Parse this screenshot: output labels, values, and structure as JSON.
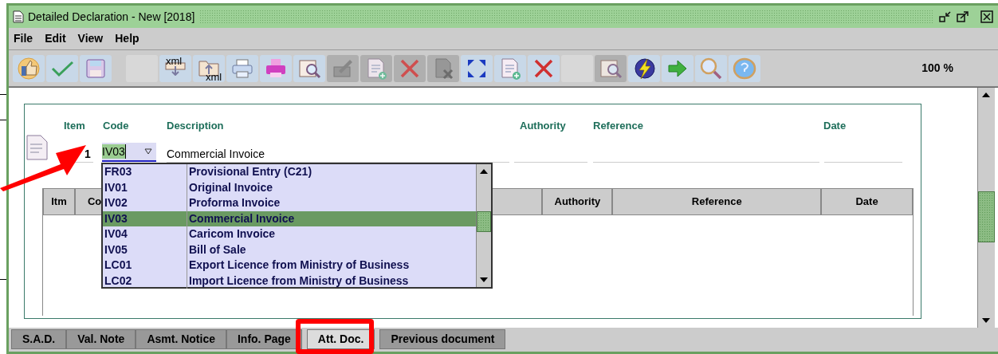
{
  "window": {
    "title": "Detailed Declaration - New [2018]"
  },
  "menu": [
    "File",
    "Edit",
    "View",
    "Help"
  ],
  "toolbar": {
    "buttons": [
      {
        "disabled": false
      },
      {
        "disabled": false
      },
      {
        "disabled": false
      },
      {
        "disabled": true
      },
      {
        "disabled": false,
        "label": "xml"
      },
      {
        "disabled": false,
        "label": "xml"
      },
      {
        "disabled": false
      },
      {
        "disabled": false
      },
      {
        "disabled": false
      },
      {
        "disabled": true
      },
      {
        "disabled": true
      },
      {
        "disabled": true
      },
      {
        "disabled": true
      },
      {
        "disabled": false
      },
      {
        "disabled": false
      },
      {
        "disabled": false
      },
      {
        "disabled": true
      },
      {
        "disabled": true
      },
      {
        "disabled": false
      },
      {
        "disabled": false
      },
      {
        "disabled": false
      },
      {
        "disabled": false
      }
    ],
    "zoom": "100 %"
  },
  "form": {
    "labels": [
      "Item",
      "Code",
      "Description",
      "Authority",
      "Reference",
      "Date"
    ],
    "item": "1",
    "code": "IV03",
    "description": "Commercial Invoice"
  },
  "dropdown": {
    "rows": [
      {
        "code": "FR03",
        "description": "Provisional Entry (C21)",
        "selected": false
      },
      {
        "code": "IV01",
        "description": "Original Invoice",
        "selected": false
      },
      {
        "code": "IV02",
        "description": "Proforma Invoice",
        "selected": false
      },
      {
        "code": "IV03",
        "description": "Commercial Invoice",
        "selected": true
      },
      {
        "code": "IV04",
        "description": "Caricom Invoice",
        "selected": false
      },
      {
        "code": "IV05",
        "description": "Bill of Sale",
        "selected": false
      },
      {
        "code": "LC01",
        "description": "Export Licence from Ministry of Business",
        "selected": false
      },
      {
        "code": "LC02",
        "description": "Import Licence from Ministry of Business",
        "selected": false
      }
    ]
  },
  "table": {
    "columns": [
      "Itm",
      "Co",
      "Authority",
      "Reference",
      "Date"
    ]
  },
  "tabs": [
    {
      "label": "S.A.D.",
      "selected": false
    },
    {
      "label": "Val. Note",
      "selected": false
    },
    {
      "label": "Asmt. Notice",
      "selected": false
    },
    {
      "label": "Info. Page",
      "selected": false
    },
    {
      "label": "Att. Doc.",
      "selected": true
    },
    {
      "label": "Previous document",
      "selected": false
    }
  ]
}
